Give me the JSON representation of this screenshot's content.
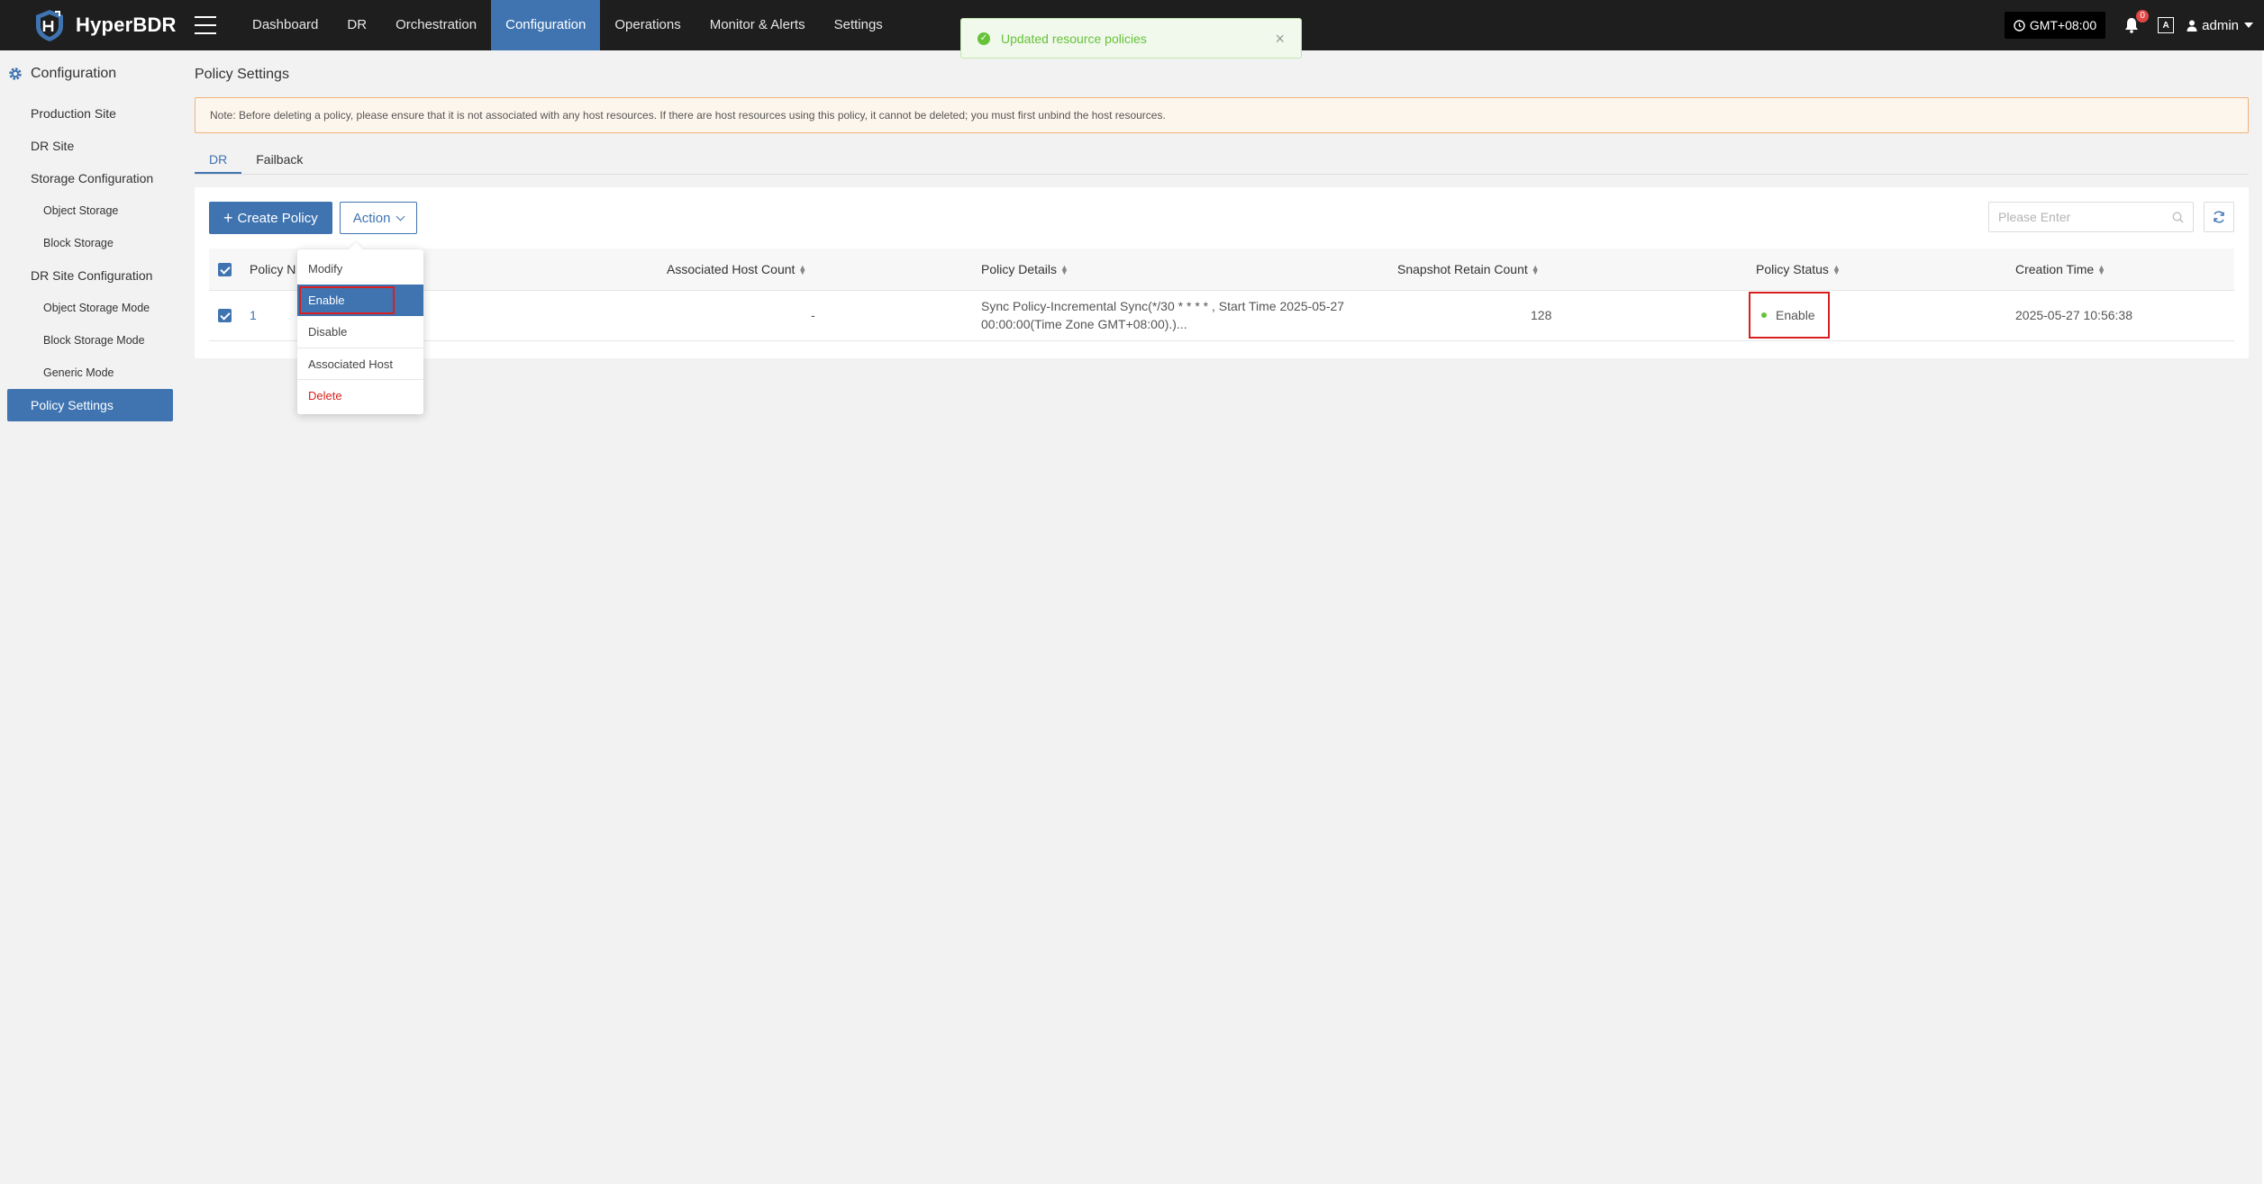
{
  "app": {
    "name": "HyperBDR"
  },
  "nav": {
    "items": [
      {
        "label": "Dashboard",
        "active": false
      },
      {
        "label": "DR",
        "active": false
      },
      {
        "label": "Orchestration",
        "active": false
      },
      {
        "label": "Configuration",
        "active": true
      },
      {
        "label": "Operations",
        "active": false
      },
      {
        "label": "Monitor & Alerts",
        "active": false
      },
      {
        "label": "Settings",
        "active": false
      }
    ]
  },
  "header": {
    "timezone": "GMT+08:00",
    "notification_count": "0",
    "lang_icon": "A",
    "user": "admin"
  },
  "toast": {
    "message": "Updated resource policies",
    "type": "success"
  },
  "sidebar": {
    "title": "Configuration",
    "items": [
      {
        "label": "Production Site",
        "level": 1
      },
      {
        "label": "DR Site",
        "level": 1
      },
      {
        "label": "Storage Configuration",
        "level": 1
      },
      {
        "label": "Object Storage",
        "level": 2
      },
      {
        "label": "Block Storage",
        "level": 2
      },
      {
        "label": "DR Site Configuration",
        "level": 1
      },
      {
        "label": "Object Storage Mode",
        "level": 2
      },
      {
        "label": "Block Storage Mode",
        "level": 2
      },
      {
        "label": "Generic Mode",
        "level": 2
      },
      {
        "label": "Policy Settings",
        "level": 1,
        "active": true
      }
    ]
  },
  "page": {
    "title": "Policy Settings",
    "notice": "Note: Before deleting a policy, please ensure that it is not associated with any host resources. If there are host resources using this policy, it cannot be deleted; you must first unbind the host resources.",
    "tabs": [
      {
        "label": "DR",
        "active": true
      },
      {
        "label": "Failback",
        "active": false
      }
    ],
    "create_button": "Create Policy",
    "action_button": "Action",
    "search_placeholder": "Please Enter"
  },
  "action_menu": {
    "items": [
      {
        "label": "Modify"
      },
      {
        "label": "Enable",
        "active": true
      },
      {
        "label": "Disable"
      },
      {
        "label": "Associated Host"
      },
      {
        "label": "Delete",
        "danger": true
      }
    ]
  },
  "table": {
    "columns": [
      "Policy N",
      "Associated Host Count",
      "Policy Details",
      "Snapshot Retain Count",
      "Policy Status",
      "Creation Time"
    ],
    "rows": [
      {
        "policy_name": "1",
        "associated_host_count": "-",
        "policy_details_line1": "Sync Policy-Incremental Sync(*/30 * * * * , Start Time 2025-05-27",
        "policy_details_line2": "00:00:00(Time Zone GMT+08:00).)...",
        "snapshot_retain_count": "128",
        "policy_status": "Enable",
        "creation_time": "2025-05-27 10:56:38"
      }
    ]
  },
  "colors": {
    "primary": "#3f74b1",
    "topbar": "#1e1e1e",
    "success": "#67c23a",
    "danger": "#d91f1f",
    "notice_border": "#f0b27a"
  }
}
